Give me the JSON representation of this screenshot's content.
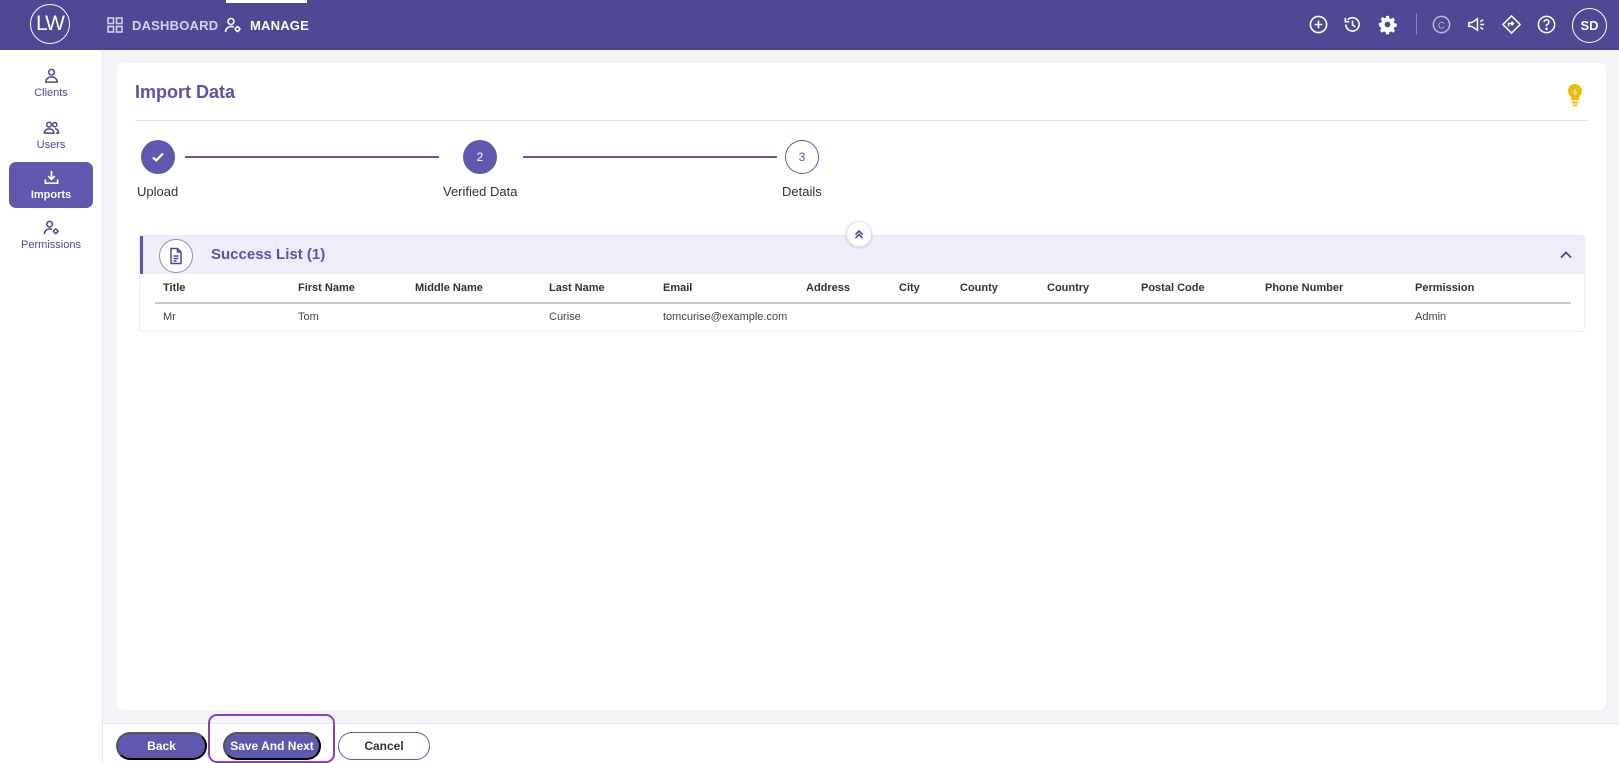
{
  "app": {
    "logo_text": "LW",
    "nav": [
      {
        "label": "DASHBOARD",
        "icon": "dashboard-grid-icon"
      },
      {
        "label": "MANAGE",
        "icon": "user-gear-icon"
      }
    ],
    "toolbar_icons": [
      "add-circle-icon",
      "history-icon",
      "settings-gear-icon",
      "coin-icon",
      "megaphone-icon",
      "directions-icon",
      "help-icon"
    ],
    "avatar_initials": "SD"
  },
  "sidebar": {
    "items": [
      {
        "label": "Clients",
        "icon": "person-icon"
      },
      {
        "label": "Users",
        "icon": "people-icon"
      },
      {
        "label": "Imports",
        "icon": "download-icon"
      },
      {
        "label": "Permissions",
        "icon": "user-gear-icon"
      }
    ],
    "active": "Imports"
  },
  "page": {
    "title": "Import Data",
    "tip_icon": "lightbulb-icon"
  },
  "stepper": {
    "steps": [
      {
        "label": "Upload",
        "number": "1",
        "state": "done"
      },
      {
        "label": "Verified Data",
        "number": "2",
        "state": "current"
      },
      {
        "label": "Details",
        "number": "3",
        "state": "todo"
      }
    ]
  },
  "success_list": {
    "title": "Success List (1)",
    "columns": [
      "Title",
      "First Name",
      "Middle Name",
      "Last Name",
      "Email",
      "Address",
      "City",
      "County",
      "Country",
      "Postal Code",
      "Phone Number",
      "Permission"
    ],
    "rows": [
      [
        "Mr",
        "Tom",
        "",
        "Curise",
        "tomcurise@example.com",
        "",
        "",
        "",
        "",
        "",
        "",
        "Admin"
      ]
    ]
  },
  "footer": {
    "back_label": "Back",
    "save_next_label": "Save And Next",
    "cancel_label": "Cancel"
  },
  "colors": {
    "brand": "#4e4895",
    "accent": "#5f58ae",
    "panel_bg": "#efedfa",
    "tip": "#f5b800"
  }
}
